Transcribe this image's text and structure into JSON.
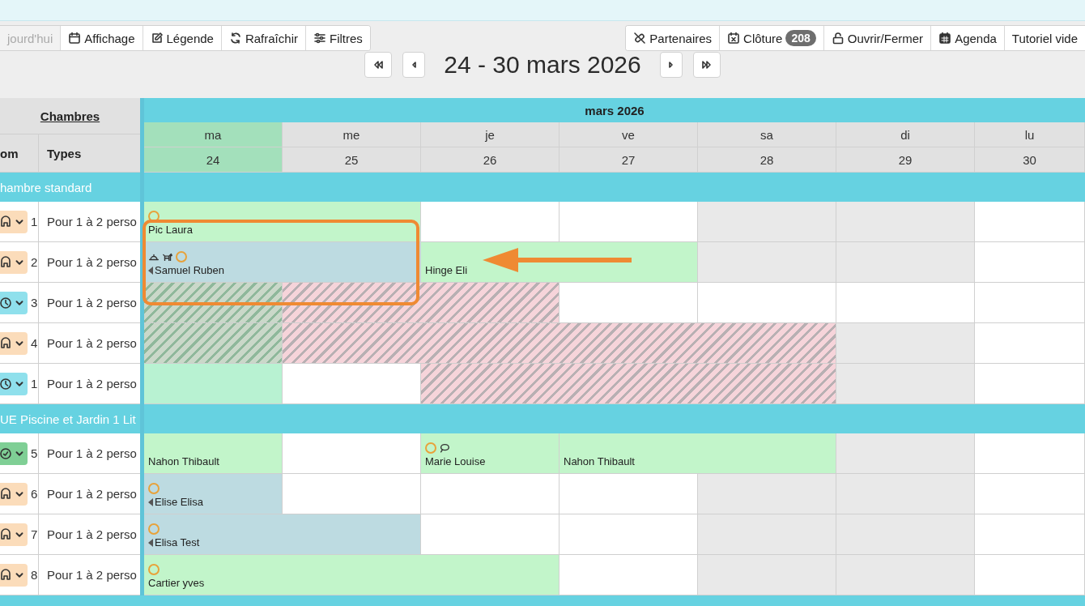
{
  "toolbar": {
    "left_buttons": [
      {
        "label": "jourd'hui",
        "disabled": true
      },
      {
        "label": "Affichage",
        "disabled": false
      },
      {
        "label": "Légende",
        "disabled": false
      },
      {
        "label": "Rafraîchir",
        "disabled": false
      },
      {
        "label": "Filtres",
        "disabled": false
      }
    ],
    "right_buttons": [
      {
        "label": "Partenaires"
      },
      {
        "label": "Clôture",
        "badge": "208"
      },
      {
        "label": "Ouvrir/Fermer"
      },
      {
        "label": "Agenda"
      },
      {
        "label": "Tutoriel vide"
      }
    ]
  },
  "week_nav": {
    "title": "24 - 30 mars 2026"
  },
  "calendar": {
    "rooms_heading": "Chambres",
    "column_headers": [
      "om",
      "Types"
    ],
    "month": "mars 2026",
    "days": [
      {
        "name": "ma",
        "number": "24",
        "selected": true
      },
      {
        "name": "me",
        "number": "25",
        "selected": false
      },
      {
        "name": "je",
        "number": "26",
        "selected": false
      },
      {
        "name": "ve",
        "number": "27",
        "selected": false
      },
      {
        "name": "sa",
        "number": "28",
        "selected": false
      },
      {
        "name": "di",
        "number": "29",
        "selected": false
      },
      {
        "name": "lu",
        "number": "30",
        "selected": false
      }
    ],
    "groups": [
      {
        "name": "hambre standard",
        "rooms": [
          {
            "status": {
              "kind": "dirty"
            },
            "number": "1",
            "type": "Pour 1 à 2 perso",
            "days": [
              {
                "kind": "booking",
                "color": "#c2f5ca",
                "name": "Pic Laura",
                "continues_before": false,
                "flags": [
                  {
                    "kind": "circle"
                  }
                ]
              },
              {
                "kind": "continued"
              },
              {
                "kind": "empty"
              },
              {
                "kind": "empty"
              },
              {
                "kind": "closed"
              },
              {
                "kind": "closed"
              },
              {
                "kind": "empty"
              }
            ]
          },
          {
            "status": {
              "kind": "dirty"
            },
            "number": "2",
            "type": "Pour 1 à 2 perso",
            "days": [
              {
                "kind": "booking",
                "color": "#bddbe1",
                "name": "Samuel Ruben",
                "continues_before": true,
                "flags": [
                  {
                    "kind": "bell"
                  },
                  {
                    "kind": "pet"
                  },
                  {
                    "kind": "circle"
                  }
                ]
              },
              {
                "kind": "continued"
              },
              {
                "kind": "booking",
                "color": "#c2f5ca",
                "name": "Hinge Eli",
                "continues_before": false
              },
              {
                "kind": "continued"
              },
              {
                "kind": "closed"
              },
              {
                "kind": "closed"
              },
              {
                "kind": "empty"
              }
            ]
          },
          {
            "status": {
              "kind": "pending"
            },
            "number": "3",
            "type": "Pour 1 à 2 perso",
            "days": [
              {
                "kind": "blocked",
                "color": "#cad8c9"
              },
              {
                "kind": "blocked",
                "color": "#f6d4da"
              },
              {
                "kind": "continued"
              },
              {
                "kind": "empty"
              },
              {
                "kind": "empty"
              },
              {
                "kind": "empty"
              },
              {
                "kind": "empty"
              }
            ]
          },
          {
            "status": {
              "kind": "dirty"
            },
            "number": "4",
            "type": "Pour 1 à 2 perso",
            "days": [
              {
                "kind": "blocked",
                "color": "#cad8c9"
              },
              {
                "kind": "blocked",
                "color": "#f6d4da"
              },
              {
                "kind": "continued"
              },
              {
                "kind": "continued"
              },
              {
                "kind": "continued"
              },
              {
                "kind": "closed"
              },
              {
                "kind": "empty"
              }
            ]
          },
          {
            "status": {
              "kind": "pending"
            },
            "number": "1",
            "type": "Pour 1 à 2 perso",
            "days": [
              {
                "kind": "booking",
                "color": "#b8f2d2",
                "continues_before": false
              },
              {
                "kind": "empty"
              },
              {
                "kind": "blocked",
                "color": "#f6d4da"
              },
              {
                "kind": "continued"
              },
              {
                "kind": "continued"
              },
              {
                "kind": "closed"
              },
              {
                "kind": "empty"
              }
            ]
          }
        ]
      },
      {
        "name": "UE Piscine et Jardin 1 Lit",
        "rooms": [
          {
            "status": {
              "kind": "clean"
            },
            "number": "5",
            "type": "Pour 1 à 2 perso",
            "days": [
              {
                "kind": "booking",
                "color": "#c2f5ca",
                "name": "Nahon Thibault",
                "continues_before": false
              },
              {
                "kind": "empty"
              },
              {
                "kind": "booking",
                "color": "#c2f5ca",
                "name": "Marie Louise",
                "continues_before": false,
                "flags": [
                  {
                    "kind": "circle"
                  },
                  {
                    "kind": "comment"
                  }
                ]
              },
              {
                "kind": "booking",
                "color": "#c2f5ca",
                "name": "Nahon Thibault",
                "continues_before": false
              },
              {
                "kind": "continued"
              },
              {
                "kind": "closed"
              },
              {
                "kind": "empty"
              }
            ]
          },
          {
            "status": {
              "kind": "dirty"
            },
            "number": "6",
            "type": "Pour 1 à 2 perso",
            "days": [
              {
                "kind": "booking",
                "color": "#bddbe1",
                "name": "Elise Elisa",
                "continues_before": true,
                "flags": [
                  {
                    "kind": "circle"
                  }
                ]
              },
              {
                "kind": "empty"
              },
              {
                "kind": "empty"
              },
              {
                "kind": "empty"
              },
              {
                "kind": "closed"
              },
              {
                "kind": "closed"
              },
              {
                "kind": "empty"
              }
            ]
          },
          {
            "status": {
              "kind": "dirty"
            },
            "number": "7",
            "type": "Pour 1 à 2 perso",
            "days": [
              {
                "kind": "booking",
                "color": "#bddbe1",
                "name": "Elisa Test",
                "continues_before": true,
                "flags": [
                  {
                    "kind": "circle"
                  }
                ]
              },
              {
                "kind": "continued"
              },
              {
                "kind": "empty"
              },
              {
                "kind": "empty"
              },
              {
                "kind": "closed"
              },
              {
                "kind": "closed"
              },
              {
                "kind": "empty"
              }
            ]
          },
          {
            "status": {
              "kind": "dirty"
            },
            "number": "8",
            "type": "Pour 1 à 2 perso",
            "days": [
              {
                "kind": "booking",
                "color": "#c2f5ca",
                "name": "Cartier yves",
                "continues_before": false,
                "flags": [
                  {
                    "kind": "circle"
                  }
                ]
              },
              {
                "kind": "continued"
              },
              {
                "kind": "continued"
              },
              {
                "kind": "empty"
              },
              {
                "kind": "closed"
              },
              {
                "kind": "closed"
              },
              {
                "kind": "empty"
              }
            ]
          }
        ]
      }
    ]
  }
}
